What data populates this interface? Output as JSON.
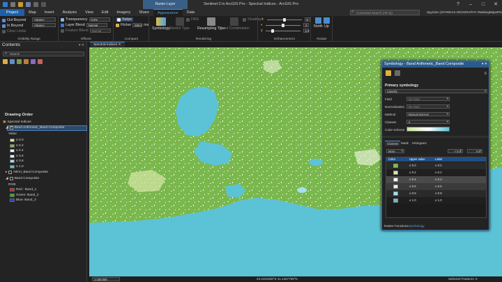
{
  "window": {
    "title": "Sentinel-2 in ArcGIS Pro - Spectral Indices - ArcGIS Pro",
    "contextual_tab_group": "Raster Layer",
    "tabs": [
      "Project",
      "Map",
      "Insert",
      "Analysis",
      "View",
      "Edit",
      "Imagery",
      "Share",
      "Appearance",
      "Data"
    ],
    "active_tab": "Appearance",
    "command_search_placeholder": "Command Search (Alt+Q)",
    "user": "Spyridon (STARDAS.GEOGRAPHY #MakingMapsPretty)"
  },
  "ribbon": {
    "visibility_range": {
      "label": "Visibility Range",
      "out_beyond": "Out Beyond",
      "in_beyond": "In Beyond",
      "clear_limits": "Clear Limits",
      "out_value": "<None>",
      "in_value": "<None>"
    },
    "effects": {
      "label": "Effects",
      "transparency_label": "Transparency",
      "transparency_value": "0.0%",
      "layer_blend_label": "Layer Blend",
      "layer_blend_value": "Normal",
      "feature_blend_label": "Feature Blend",
      "feature_blend_value": "Normal",
      "swipe_label": "Swipe",
      "flicker_label": "Flicker",
      "flicker_value": "500.0",
      "flicker_unit": "ms"
    },
    "compare": {
      "label": "Compare"
    },
    "drawing": {
      "symbology_label": "Symbology",
      "stretch_type_label": "Stretch Type",
      "dra_label": "DRA",
      "resampling_label": "Resampling Type",
      "band_combination_label": "Band Combination",
      "shading_label": "Shading",
      "label": "Rendering"
    },
    "enhancement": {
      "label": "Enhancement",
      "brightness_value": "0",
      "contrast_value": "0",
      "gamma_value": "1.0"
    },
    "rotate": {
      "label": "Rotate",
      "north_label": "North",
      "up_label": "Up"
    }
  },
  "contents": {
    "title": "Contents",
    "search_placeholder": "Search",
    "drawing_order": "Drawing Order",
    "map_name": "Spectral Indices",
    "layer1": "Band Arithmetic_Band Composite",
    "value_label": "Value",
    "legend": [
      {
        "label": "≤ 0.0",
        "color": "#d8e7a6"
      },
      {
        "label": "≤ 0.2",
        "color": "#7fbf44"
      },
      {
        "label": "≤ 0.4",
        "color": "#ffffff"
      },
      {
        "label": "≤ 0.6",
        "color": "#dff3f7"
      },
      {
        "label": "≤ 0.8",
        "color": "#a3e1ec"
      },
      {
        "label": "≤ 1.0",
        "color": "#5cc3d6"
      }
    ],
    "layer2": "NDVI_Band Composite",
    "layer3": "Band Composite",
    "rgb_label": "RGB",
    "rgb": [
      {
        "label": "Red : Band_1",
        "color": "#e02020"
      },
      {
        "label": "Green: Band_2",
        "color": "#20c020"
      },
      {
        "label": "Blue: Band_3",
        "color": "#2040e0"
      }
    ]
  },
  "map": {
    "tab": "Spectral Indices",
    "scale": "1:150,000",
    "coords": "23.4151928°E 41.1457705°N",
    "selected_features": "Selected Features: 0"
  },
  "symbology": {
    "title": "Symbology - Band Arithmetic_Band Composite",
    "primary": "Primary symbology",
    "renderer": "Classify",
    "field_label": "Field",
    "field_value": "No Field",
    "norm_label": "Normalization",
    "norm_value": "No Field",
    "method_label": "Method",
    "method_value": "Manual Interval",
    "classes_label": "Classes",
    "classes_value": "6",
    "scheme_label": "Color scheme",
    "subtabs": [
      "Classes",
      "Mask",
      "Histogram"
    ],
    "more_label": "More",
    "min_value": "< 0.0",
    "max_value": "0.0",
    "col_color": "Color",
    "col_upper": "Upper value",
    "col_label": "Label",
    "rows": [
      {
        "upper": "≤   0.0",
        "label": "≤ 0.0",
        "color": "#7fbf44"
      },
      {
        "upper": "≤   0.2",
        "label": "≤ 0.2",
        "color": "#d8e7a6"
      },
      {
        "upper": "≤   0.4",
        "label": "≤ 0.4",
        "color": "#ffffff"
      },
      {
        "upper": "≤   0.6",
        "label": "≤ 0.6",
        "color": "#dff3f7"
      },
      {
        "upper": "≤   0.8",
        "label": "≤ 0.8",
        "color": "#a3e1ec"
      },
      {
        "upper": "≤   1.0",
        "label": "≤ 1.0",
        "color": "#5cc3d6"
      }
    ],
    "bottom_tabs": [
      "Raster Functions",
      "Symbology"
    ]
  },
  "colors": {
    "accent": "#1e5fa8",
    "land": "#7ab84e",
    "water": "#5cc3d6"
  }
}
